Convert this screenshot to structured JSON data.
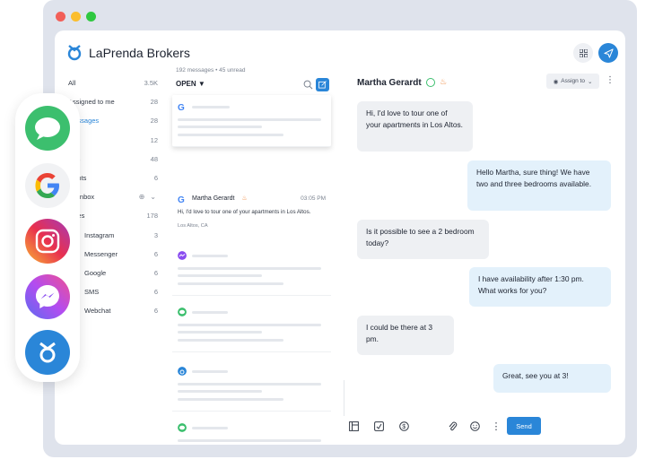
{
  "window": {
    "brand": "LaPrenda Brokers",
    "colors": {
      "accent": "#2a86d8",
      "red": "#f25f58",
      "yellow": "#fbbe2e",
      "green": "#2fc840"
    }
  },
  "folders": [
    {
      "label": "All",
      "count": "3.5K"
    },
    {
      "label": "Assigned to me",
      "count": "28"
    },
    {
      "label": "Messages",
      "count": "28"
    },
    {
      "label": "ds",
      "count": "12"
    },
    {
      "label": "ews",
      "count": "48"
    },
    {
      "label": "ments",
      "count": "6"
    },
    {
      "label": "art Inbox",
      "count": ""
    },
    {
      "label": "tages",
      "count": "178"
    },
    {
      "label": "Instagram",
      "count": "3"
    },
    {
      "label": "Messenger",
      "count": "6"
    },
    {
      "label": "Google",
      "count": "6"
    },
    {
      "label": "SMS",
      "count": "6"
    },
    {
      "label": "Webchat",
      "count": "6"
    }
  ],
  "list": {
    "meta": "192 messages • 45 unread",
    "filter": "OPEN",
    "featured": {
      "name": "Martha Gerardt",
      "time": "03:05 PM",
      "preview": "Hi, I'd love to tour one of your apartments in Los Altos.",
      "location": "Los Altos, CA"
    }
  },
  "chat": {
    "contact": "Martha Gerardt",
    "assign_label": "Assign to",
    "messages": [
      {
        "dir": "in",
        "text": "Hi, I'd love to tour one of your apartments in Los Altos."
      },
      {
        "dir": "out",
        "text": "Hello Martha, sure thing! We have two and three bedrooms available."
      },
      {
        "dir": "in",
        "text": "Is it possible to see a 2 bedroom today?"
      },
      {
        "dir": "out",
        "text": "I have availability after 1:30 pm. What works for you?"
      },
      {
        "dir": "in",
        "text": "I could be there at 3 pm."
      },
      {
        "dir": "out",
        "text": "Great, see you at 3!"
      }
    ],
    "send_label": "Send"
  },
  "dock": {
    "channels": [
      "messages-icon",
      "google-icon",
      "instagram-icon",
      "messenger-icon",
      "birdeye-icon"
    ]
  }
}
